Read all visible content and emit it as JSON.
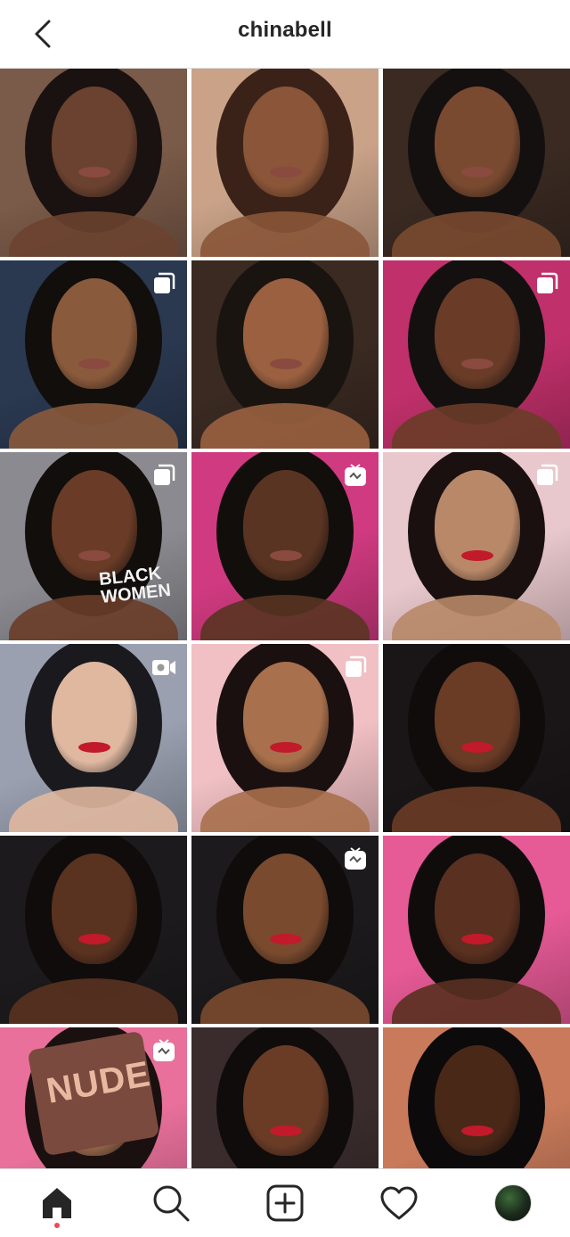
{
  "header": {
    "title": "chinabell",
    "back_icon": "chevron-left-icon"
  },
  "grid": {
    "tiles": [
      {
        "badge": "none",
        "bg": "#7a5a48",
        "skin": "#6b4230",
        "hair": "#1a1210"
      },
      {
        "badge": "none",
        "bg": "#c9a288",
        "skin": "#8a5538",
        "hair": "#3a2218"
      },
      {
        "badge": "none",
        "bg": "#3a2a22",
        "skin": "#7a4a30",
        "hair": "#151010"
      },
      {
        "badge": "carousel",
        "bg": "#2a3850",
        "skin": "#8a5a3c",
        "hair": "#120e0c"
      },
      {
        "badge": "none",
        "bg": "#3a2a22",
        "skin": "#9a6040",
        "hair": "#1a1410"
      },
      {
        "badge": "carousel",
        "bg": "#c0306a",
        "skin": "#6a3c28",
        "hair": "#141010"
      },
      {
        "badge": "carousel",
        "bg": "#8a8a90",
        "skin": "#6a3c28",
        "hair": "#120e0c"
      },
      {
        "badge": "igtv",
        "bg": "#d03a80",
        "skin": "#5a3422",
        "hair": "#120e0c"
      },
      {
        "badge": "carousel",
        "bg": "#e8c8cc",
        "skin": "#b88868",
        "hair": "#1a1010"
      },
      {
        "badge": "video",
        "bg": "#9aa0b0",
        "skin": "#e0b8a0",
        "hair": "#1a1a1e"
      },
      {
        "badge": "carousel",
        "bg": "#f0c0c4",
        "skin": "#a8704c",
        "hair": "#1a1010"
      },
      {
        "badge": "none",
        "bg": "#1a1618",
        "skin": "#6a3c26",
        "hair": "#100c0c"
      },
      {
        "badge": "none",
        "bg": "#1c1a1c",
        "skin": "#5a3220",
        "hair": "#100c0c"
      },
      {
        "badge": "igtv",
        "bg": "#1c1a1c",
        "skin": "#7a4a2e",
        "hair": "#100c0c"
      },
      {
        "badge": "none",
        "bg": "#e65a96",
        "skin": "#5a3020",
        "hair": "#100c0c"
      },
      {
        "badge": "igtv",
        "bg": "#e8709a",
        "skin": "#9a6a4c",
        "hair": "#1a1010",
        "overlay_text": "NUDE"
      },
      {
        "badge": "none",
        "bg": "#3a2c2c",
        "skin": "#6a3c26",
        "hair": "#100c0c"
      },
      {
        "badge": "none",
        "bg": "#c87a5a",
        "skin": "#4a2818",
        "hair": "#0c0a0a"
      }
    ],
    "shirt_text": "BLACK WOMEN"
  },
  "bottom_nav": {
    "items": [
      "home-icon",
      "search-icon",
      "new-post-icon",
      "activity-icon",
      "profile-avatar"
    ],
    "active": "home-icon",
    "dot_color": "#ed4956"
  },
  "colors": {
    "text": "#262626",
    "divider": "#dbdbdb",
    "background": "#ffffff"
  }
}
